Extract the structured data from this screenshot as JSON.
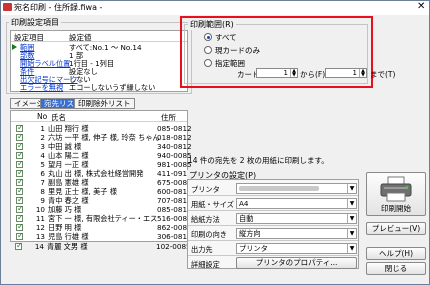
{
  "window": {
    "title": "宛名印刷 - 住所録.fiwa -",
    "close_glyph": "✕"
  },
  "settings_panel": {
    "group_title": "印刷設定項目",
    "col_item": "設定項目",
    "col_value": "設定値",
    "rows": [
      {
        "label": "範囲",
        "value": "すべて:No.1 〜 No.14"
      },
      {
        "label": "部数",
        "value": "1 部"
      },
      {
        "label": "開始ラベル位置",
        "value": "1行目 - 1列目"
      },
      {
        "label": "条件",
        "value": "設定なし"
      },
      {
        "label": "出欠記号にマーク",
        "value": "しない"
      },
      {
        "label": "エラーを無視",
        "value": "エコーしないうず縁しない"
      }
    ]
  },
  "tabs": [
    {
      "label": "イメージ"
    },
    {
      "label": "宛先リスト"
    },
    {
      "label": "印刷除外リスト"
    }
  ],
  "address_list": {
    "col_no": "No",
    "col_name": "氏名",
    "col_addr": "住所",
    "rows": [
      {
        "no": "1",
        "name": "山田 翔行 様",
        "addr": "085-0812"
      },
      {
        "no": "2",
        "name": "六坊 一平 様, 伸子 様, 玲奈 ちゃん",
        "addr": "018-0812"
      },
      {
        "no": "3",
        "name": "中田 誠 様",
        "addr": "340-0812"
      },
      {
        "no": "4",
        "name": "山本 陽二 様",
        "addr": "940-0085"
      },
      {
        "no": "5",
        "name": "望月 一正 様",
        "addr": "981-0085"
      },
      {
        "no": "6",
        "name": "丸山 出 様, 株式会社経営開発",
        "addr": "411-0916"
      },
      {
        "no": "7",
        "name": "副島 憲雄 様",
        "addr": "675-0081"
      },
      {
        "no": "8",
        "name": "里見 正士 様, 美子 様",
        "addr": "600-0812"
      },
      {
        "no": "9",
        "name": "青中 春之 様",
        "addr": "707-0812"
      },
      {
        "no": "10",
        "name": "加藤 巧 様",
        "addr": "085-0812"
      },
      {
        "no": "11",
        "name": "宮下 一 様, 有限会社ティー・エス",
        "addr": "516-0085"
      },
      {
        "no": "12",
        "name": "日野 明 様",
        "addr": "862-0085"
      },
      {
        "no": "13",
        "name": "児島 行雄 様",
        "addr": "306-0812"
      },
      {
        "no": "14",
        "name": "青麗 文男 様",
        "addr": "102-0085"
      }
    ]
  },
  "print_range": {
    "group_title": "印刷範囲(R)",
    "options": [
      {
        "label": "すべて",
        "selected": true
      },
      {
        "label": "現カードのみ",
        "selected": false
      },
      {
        "label": "指定範囲",
        "selected": false
      }
    ],
    "card_label": "カード",
    "from_value": "1",
    "from_label": "から(F)",
    "to_value": "1",
    "to_label": "まで(T)",
    "highlight_color": "#e8101c"
  },
  "summary_text": "14 件の宛先を 2 枚の用紙に印刷します。",
  "printer_settings": {
    "group_title": "プリンタの設定(P)",
    "rows": [
      {
        "key": "プリンタ",
        "value": ""
      },
      {
        "key": "用紙・サイズ",
        "value": "A4"
      },
      {
        "key": "給紙方法",
        "value": "自動"
      },
      {
        "key": "印刷の向き",
        "value": "縦方向"
      },
      {
        "key": "出力先",
        "value": "プリンタ"
      }
    ],
    "detail_label": "詳細設定",
    "properties_button": "プリンタのプロパティ..."
  },
  "buttons": {
    "print_start": "印刷開始",
    "preview": "プレビュー(V)",
    "help": "ヘルプ(H)",
    "close": "閉じる"
  }
}
